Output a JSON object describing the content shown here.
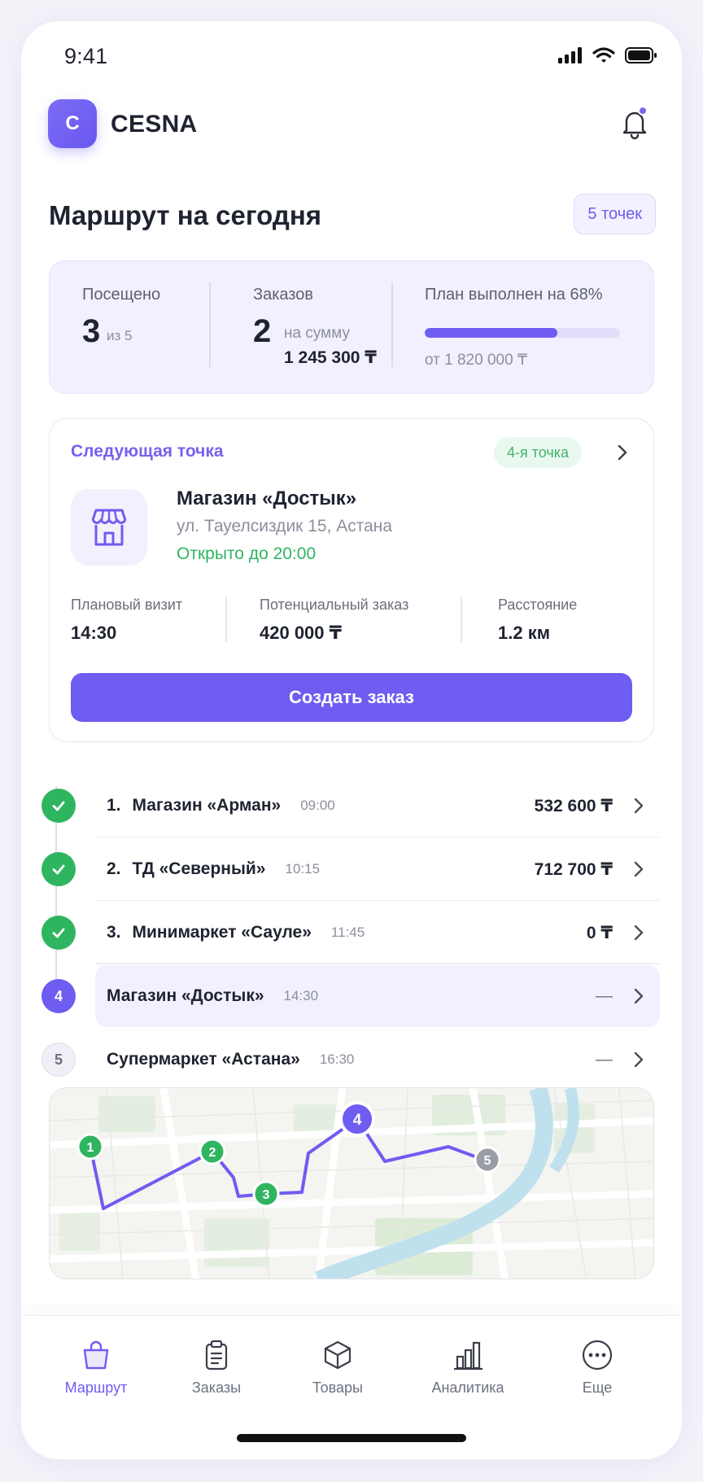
{
  "status_bar": {
    "time": "9:41"
  },
  "header": {
    "logo_letter": "C",
    "brand": "CESNA"
  },
  "route": {
    "title": "Маршрут на сегодня",
    "count_chip": "5 точек"
  },
  "stats": {
    "visited_label": "Посещено",
    "visited_value": "3",
    "visited_of": "из 5",
    "orders_label": "Заказов",
    "orders_value": "2",
    "orders_sum_label": "на сумму",
    "orders_sum": "1 245 300 ₸",
    "plan_label": "План выполнен на 68%",
    "plan_progress": 0.68,
    "plan_of": "от 1 820 000 ₸"
  },
  "next_point": {
    "label": "Следующая точка",
    "chip": "4-я точка",
    "store_name": "Магазин «Достык»",
    "address": "ул. Тауелсиздик 15, Астана",
    "open_until": "Открыто до 20:00",
    "planned_visit_label": "Плановый визит",
    "planned_visit": "14:30",
    "potential_order_label": "Потенциальный заказ",
    "potential_order": "420 000 ₸",
    "distance_label": "Расстояние",
    "distance": "1.2 км",
    "create_order_button": "Создать заказ"
  },
  "route_list": [
    {
      "step": "",
      "num": "1.",
      "name": "Магазин «Арман»",
      "time": "09:00",
      "amount": "532 600 ₸",
      "state": "done"
    },
    {
      "step": "",
      "num": "2.",
      "name": "ТД «Северный»",
      "time": "10:15",
      "amount": "712 700 ₸",
      "state": "done"
    },
    {
      "step": "",
      "num": "3.",
      "name": "Минимаркет «Сауле»",
      "time": "11:45",
      "amount": "0 ₸",
      "state": "done"
    },
    {
      "step": "4",
      "num": "",
      "name": "Магазин «Достык»",
      "time": "14:30",
      "amount": "—",
      "state": "current"
    },
    {
      "step": "5",
      "num": "",
      "name": "Супермаркет «Астана»",
      "time": "16:30",
      "amount": "—",
      "state": "todo"
    }
  ],
  "map": {
    "markers": [
      "1",
      "2",
      "3",
      "4",
      "5"
    ]
  },
  "tabbar": {
    "route": "Маршрут",
    "orders": "Заказы",
    "products": "Товары",
    "analytics": "Аналитика",
    "more": "Еще"
  },
  "colors": {
    "accent": "#6f5cf1",
    "success": "#2fb55f",
    "muted": "#8b8f9c",
    "done_marker": "#2fb55f",
    "future_marker": "#9a9ca6"
  },
  "icons": {
    "status": [
      "signal-icon",
      "wifi-icon",
      "battery-icon"
    ],
    "header": "bell-icon",
    "store": "storefront-icon",
    "done_step": "check-icon",
    "row_action": "chevron-right-icon",
    "tabs": [
      "shopping-bag-icon",
      "clipboard-icon",
      "box-icon",
      "bar-chart-icon",
      "more-icon"
    ]
  }
}
